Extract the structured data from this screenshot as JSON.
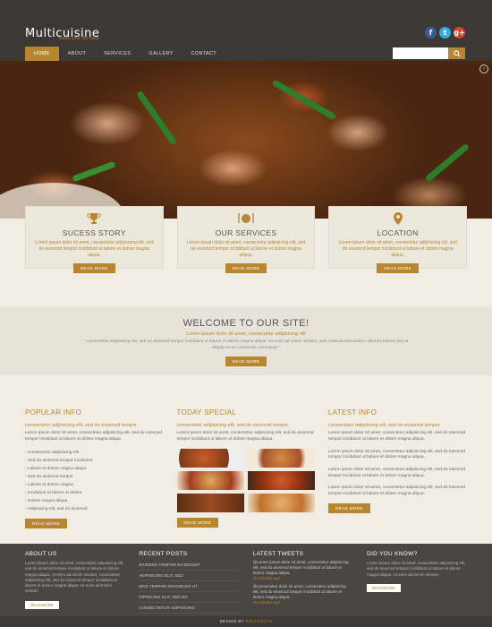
{
  "header": {
    "logo": "Multicuisine",
    "tagline": "made your life tasty",
    "socials": [
      {
        "name": "facebook",
        "glyph": "f"
      },
      {
        "name": "twitter",
        "glyph": "t"
      },
      {
        "name": "google-plus",
        "glyph": "g+"
      }
    ],
    "nav": [
      "HOME",
      "ABOUT",
      "SERVICES",
      "GALLERY",
      "CONTACT"
    ],
    "search_placeholder": ""
  },
  "features": [
    {
      "title": "SUCESS STORY",
      "text": "Lorem ipsum dolor sit amet, consectetur adipisicing elit, sed do eiusmod tempor incididunt ut labore et dolore magna aliqua.",
      "button": "READ MORE",
      "icon": "trophy-icon"
    },
    {
      "title": "OUR SERVICES",
      "text": "Lorem ipsum dolor sit amet, consectetur adipisicing elit, sed do eiusmod tempor incididunt ut labore et dolore magna aliqua.",
      "button": "READ MORE",
      "icon": "cutlery-icon"
    },
    {
      "title": "LOCATION",
      "text": "Lorem ipsum dolor sit amet, consectetur adipisicing elit, sed do eiusmod tempor incididunt ut labore et dolore magna aliqua.",
      "button": "READ MORE",
      "icon": "map-pin-icon"
    }
  ],
  "welcome": {
    "title": "WELCOME TO OUR SITE!",
    "subtitle": "Lorem ipsum dolor sit amet, consectetur adipisicing elit",
    "text": "\" consectetur adipisicing elit, sed do eiusmod tempor incididunt ut labore et dolore magna aliqua. Ut enim ad minim veniam, quis nostrud exercitation ullamco laboris nisi ut aliquip ex ea commodo consequat \"",
    "button": "READ MORE"
  },
  "popular": {
    "title": "POPULAR INFO",
    "lead": "consectetur adipisicing elit, sed do eiusmod tempor",
    "text": "Lorem ipsum dolor sit amet, consectetur adipisicing elit, sed do eiusmod tempor incididunt ut labore et dolore magna aliqua.",
    "list": [
      "Consectetur adipisicing elit",
      "Sed do eiusmod tempor incididunt",
      "Labore et dolore magna aliqua",
      "Sed do eiusmod tempor",
      "Labore et dolore magna",
      "Incididunt ut labore et dolore",
      "Dolore magna aliqua",
      "Adipisicing elit, sed do eiusmod"
    ],
    "button": "READ MORE"
  },
  "today": {
    "title": "TODAY SPECIAL",
    "lead": "consectetur adipisicing elit, sed do eiusmod tempor",
    "text": "Lorem ipsum dolor sit amet, consectetur adipisicing elit, sed do eiusmod tempor incididunt ut labore et dolore magna aliqua.",
    "button": "READ MORE"
  },
  "latest": {
    "title": "LATEST INFO",
    "lead": "consectetur adipisicing elit, sed do eiusmod tempor",
    "items": [
      "Lorem ipsum dolor sit amet, consectetur adipisicing elit, sed do eiusmod tempor incididunt ut labore et dolore magna aliqua.",
      "Lorem ipsum dolor sit amet, consectetur adipisicing elit, sed do eiusmod tempor incididunt ut labore et dolore magna aliqua.",
      "Lorem ipsum dolor sit amet, consectetur adipisicing elit, sed do eiusmod tempor incididunt ut labore et dolore magna aliqua.",
      "Lorem ipsum dolor sit amet, consectetur adipisicing elit, sed do eiusmod tempor incididunt ut labore et dolore magna aliqua."
    ],
    "button": "READ MORE"
  },
  "footer": {
    "about": {
      "title": "ABOUT US",
      "text": "Lorem ipsum dolor sit amet, consectetur adipisicing elit, sed do eiusmod tempor incididunt ut labore et dolore magna aliqua. Ut enim ad minim veniam, consectetur adipisicing elit, sed do eiusmod tempor incididunt ut labore et dolore magna aliqua. Ut enim ad minim veniam.",
      "button": "READMORE"
    },
    "recent": {
      "title": "RECENT POSTS",
      "posts": [
        "EIUSMOD TEMPOR INCIDIDUNT",
        "ADIPISICING ELIT, SED",
        "MOD TEMPOR INCIDIDUNT UT",
        "DIPISICING ELIT, SED DO",
        "CONSECTETUR ADIPISICING"
      ]
    },
    "tweets": {
      "title": "LATEST TWEETS",
      "items": [
        {
          "text": "@Lorem ipsum dolor sit amet, consectetur adipisicing elit, sed do eiusmod tempor incididunt ut labore et dolore magna aliqua.",
          "time": "15 minutes ago"
        },
        {
          "text": "@consectetur dolor sit amet, consectetur adipisicing elit, sed do eiusmod tempor incididunt ut labore et dolore magna aliqua.",
          "time": "15 minutes ago"
        }
      ]
    },
    "know": {
      "title": "DID YOU KNOW?",
      "text": "Lorem ipsum dolor sit amet, consectetur adipisicing elit, sed do eiusmod tempor incididunt ut labore et dolore magna aliqua. Ut enim ad minim veniam.",
      "button": "READMORE"
    },
    "credit_prefix": "DESIGN BY",
    "credit_name": "W3LAYOUTS"
  }
}
